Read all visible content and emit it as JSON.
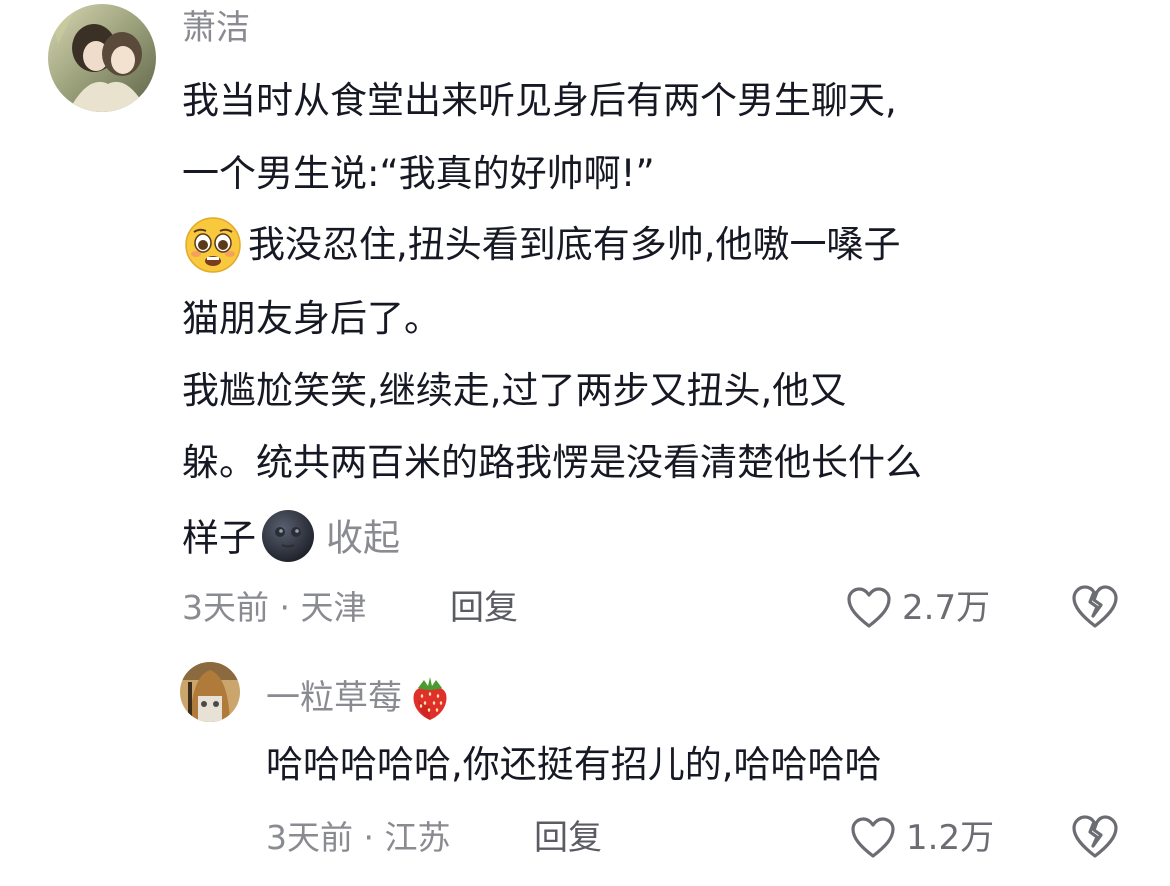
{
  "comment": {
    "author": "萧洁",
    "lines": [
      "我当时从食堂出来听见身后有两个男生聊天,",
      "一个男生说:“我真的好帅啊!”",
      "我没忍住,扭头看到底有多帅,他嗷一嗓子",
      "猫朋友身后了。",
      "我尴尬笑笑,继续走,过了两步又扭头,他又",
      "躲。统共两百米的路我愣是没看清楚他长什么",
      "样子"
    ],
    "collapse_label": "收起",
    "time_location": "3天前 · 天津",
    "reply_label": "回复",
    "like_count": "2.7万",
    "emojis": [
      "pleading-face-emoji",
      "new-moon-face-emoji"
    ]
  },
  "reply": {
    "author": "一粒草莓",
    "author_emoji": "strawberry-emoji",
    "text": "哈哈哈哈哈,你还挺有招儿的,哈哈哈哈",
    "time_location": "3天前 · 江苏",
    "reply_label": "回复",
    "like_count": "1.2万"
  },
  "icons": {
    "like": "heart-outline-icon",
    "dislike": "broken-heart-outline-icon"
  },
  "colors": {
    "text_primary": "#161823",
    "text_secondary": "#8a8b91",
    "background": "#ffffff"
  }
}
